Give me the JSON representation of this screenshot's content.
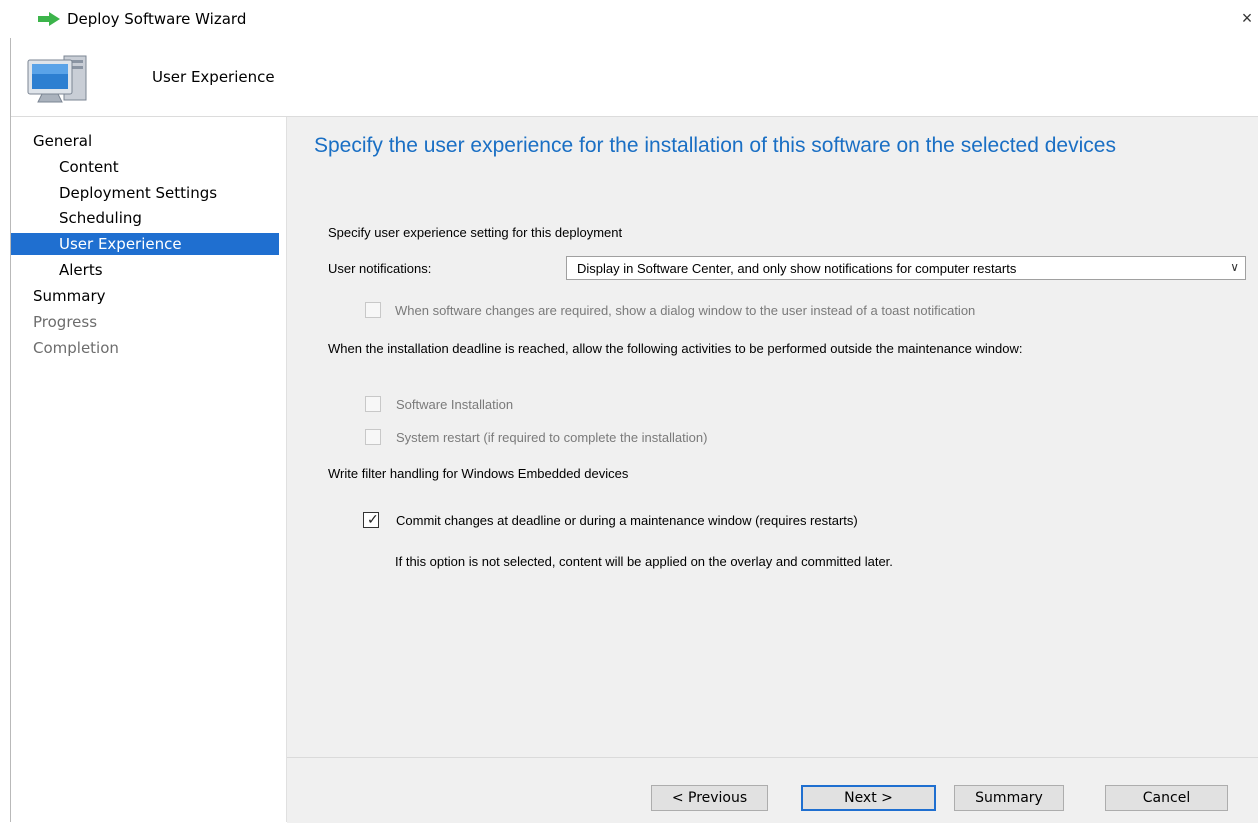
{
  "window": {
    "title": "Deploy Software Wizard",
    "close_glyph": "×"
  },
  "header": {
    "title": "User Experience",
    "icon": "computer-icon"
  },
  "sidebar": {
    "items": [
      {
        "label": "General"
      },
      {
        "label": "Content"
      },
      {
        "label": "Deployment Settings"
      },
      {
        "label": "Scheduling"
      },
      {
        "label": "User Experience"
      },
      {
        "label": "Alerts"
      },
      {
        "label": "Summary"
      },
      {
        "label": "Progress"
      },
      {
        "label": "Completion"
      }
    ]
  },
  "main": {
    "title": "Specify the user experience for the installation of this software on the selected devices",
    "intro": "Specify user experience setting for this deployment",
    "notifications_label": "User notifications:",
    "notifications_value": "Display in Software Center, and only show notifications for computer restarts",
    "dialog_option": "When software changes are required, show a dialog window to the user instead of a toast notification",
    "deadline_text": "When the installation deadline is reached, allow the following activities to be performed outside the maintenance window:",
    "software_installation": "Software Installation",
    "system_restart": "System restart  (if required to complete the installation)",
    "write_filter_text": "Write filter handling for Windows Embedded devices",
    "commit_option": "Commit changes at deadline or during a maintenance window (requires restarts)",
    "commit_note": "If this option is not selected, content will be applied on the overlay and committed later."
  },
  "footer": {
    "previous": "< Previous",
    "next": "Next >",
    "summary": "Summary",
    "cancel": "Cancel"
  },
  "colors": {
    "accent": "#1f6fd0",
    "title_blue": "#1a6fc4",
    "panel": "#f0f0f0"
  }
}
